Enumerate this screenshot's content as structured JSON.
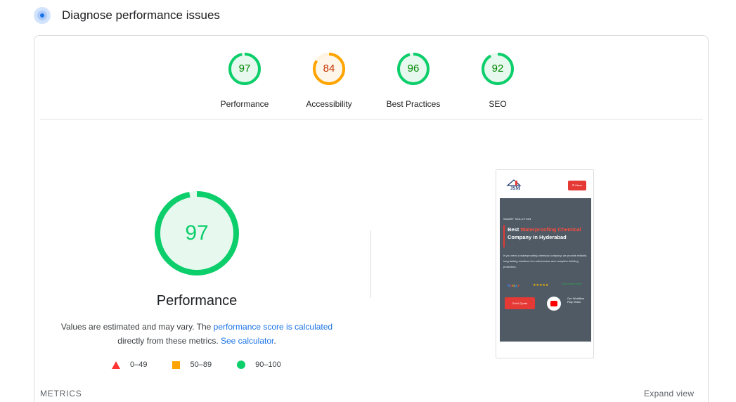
{
  "header": {
    "title": "Diagnose performance issues",
    "icon": "lighthouse-icon"
  },
  "colors": {
    "pass": "#0cce6b",
    "average": "#ffa400",
    "fail": "#ff3333",
    "link": "#1a73e8"
  },
  "summary": [
    {
      "label": "Performance",
      "score": 97,
      "rating": "pass"
    },
    {
      "label": "Accessibility",
      "score": 84,
      "rating": "average"
    },
    {
      "label": "Best Practices",
      "score": 96,
      "rating": "pass"
    },
    {
      "label": "SEO",
      "score": 92,
      "rating": "pass"
    }
  ],
  "performance": {
    "score": 97,
    "title": "Performance",
    "note_prefix": "Values are estimated and may vary. The ",
    "note_link": "performance score is calculated",
    "note_middle": " directly from these metrics. ",
    "note_calc": "See calculator",
    "note_suffix": "."
  },
  "legend": [
    {
      "shape": "triangle",
      "range": "0–49"
    },
    {
      "shape": "square",
      "range": "50–89"
    },
    {
      "shape": "circle",
      "range": "90–100"
    }
  ],
  "screenshot": {
    "logo_text": "JSM",
    "menu_label": "☰ Menu",
    "eyebrow": "SMART SOLUTION",
    "title_part1": "Best ",
    "title_red": "Waterproofing Chemical",
    "title_part2": " Company in Hyderabad",
    "description": "If you need a waterproofing chemical company, we provide reliable, long-lasting solutions for roofs,terrace and complete building protection.",
    "google": "Google",
    "stars": "★★★★★",
    "review": "Our review here",
    "cta": "Get A Quote",
    "watch": "Our Workflow Play Video"
  },
  "footer": {
    "metrics": "METRICS",
    "expand": "Expand view"
  }
}
